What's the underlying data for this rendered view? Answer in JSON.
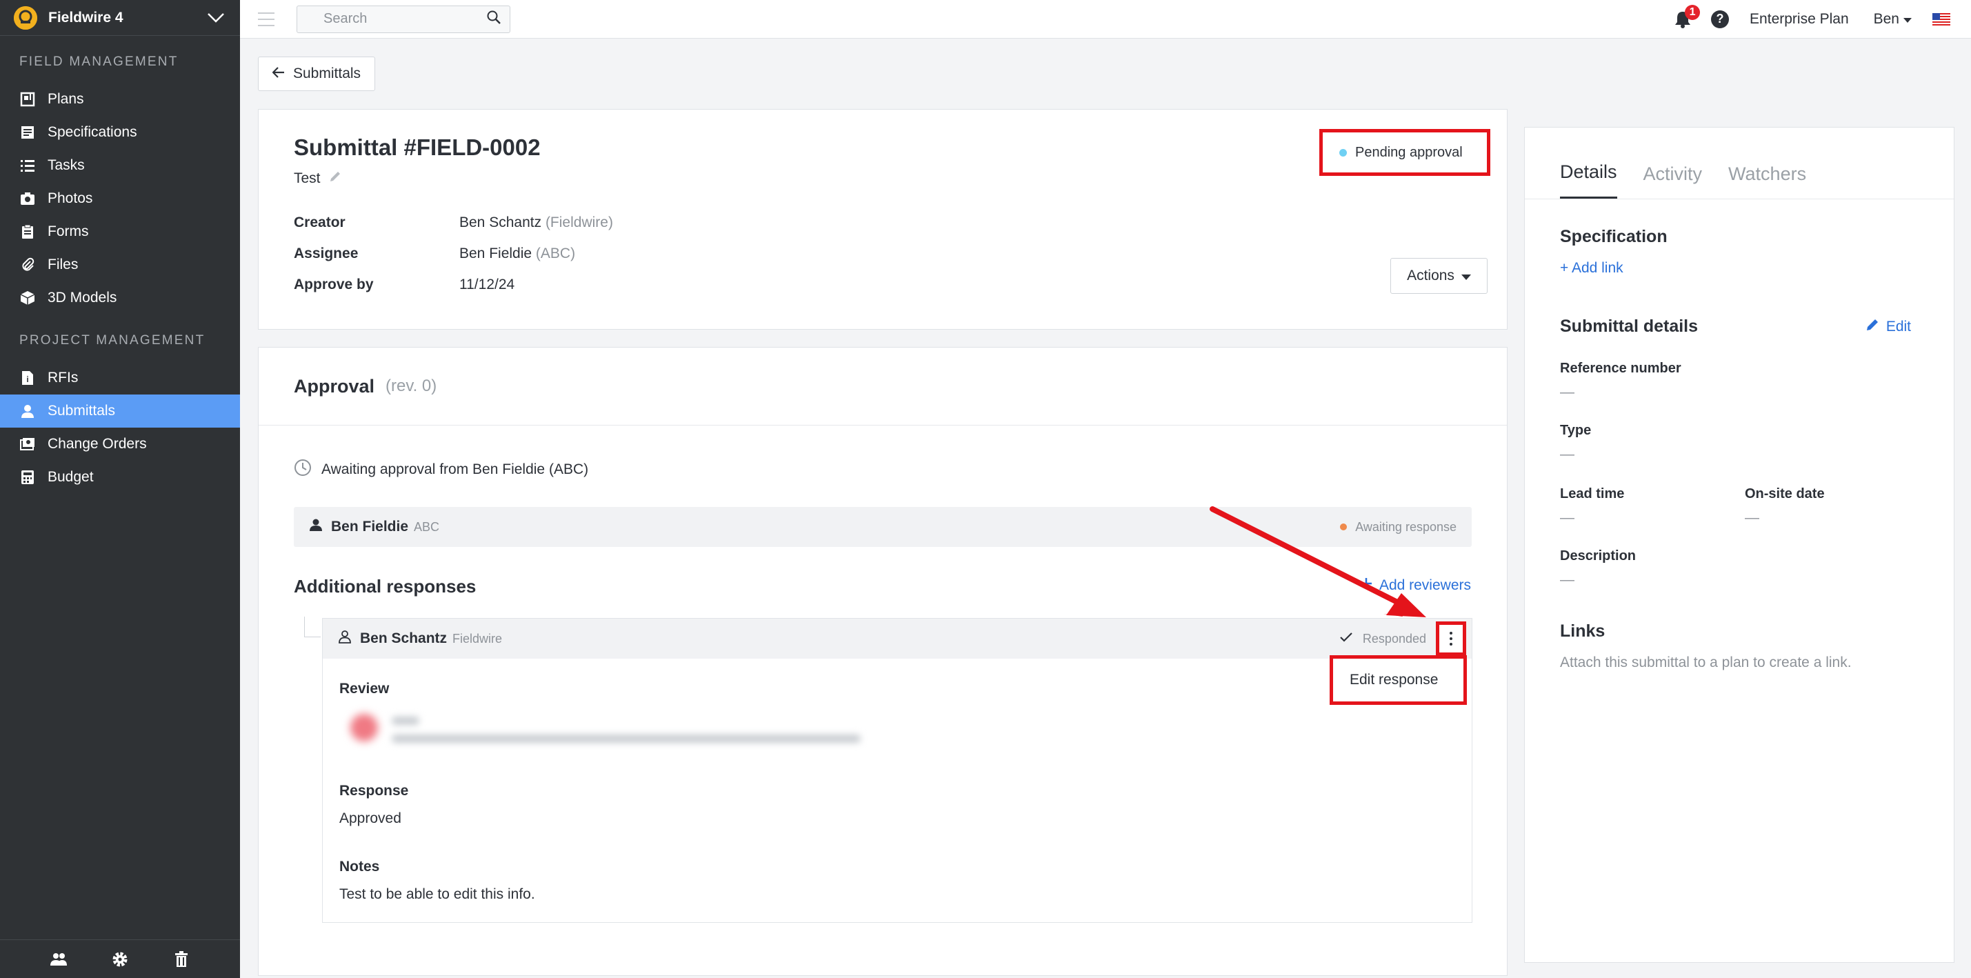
{
  "sidebar": {
    "project_name": "Fieldwire 4",
    "field_section_title": "FIELD MANAGEMENT",
    "field_items": [
      {
        "label": "Plans",
        "icon": "plans-icon"
      },
      {
        "label": "Specifications",
        "icon": "specifications-icon"
      },
      {
        "label": "Tasks",
        "icon": "tasks-icon"
      },
      {
        "label": "Photos",
        "icon": "camera-icon"
      },
      {
        "label": "Forms",
        "icon": "forms-icon"
      },
      {
        "label": "Files",
        "icon": "paperclip-icon"
      },
      {
        "label": "3D Models",
        "icon": "cube-icon"
      }
    ],
    "project_section_title": "PROJECT MANAGEMENT",
    "project_items": [
      {
        "label": "RFIs",
        "icon": "rfi-icon"
      },
      {
        "label": "Submittals",
        "icon": "submittals-icon",
        "active": true
      },
      {
        "label": "Change Orders",
        "icon": "change-orders-icon"
      },
      {
        "label": "Budget",
        "icon": "calculator-icon"
      }
    ]
  },
  "topbar": {
    "search_placeholder": "Search",
    "notification_count": "1",
    "help_label": "?",
    "plan_label": "Enterprise Plan",
    "user_label": "Ben"
  },
  "back_button": {
    "label": "Submittals"
  },
  "submittal": {
    "title": "Submittal #FIELD-0002",
    "name": "Test",
    "status": "Pending approval",
    "status_color": "#6fd0f3",
    "creator_label": "Creator",
    "creator_name": "Ben Schantz",
    "creator_org": "(Fieldwire)",
    "assignee_label": "Assignee",
    "assignee_name": "Ben Fieldie",
    "assignee_org": "(ABC)",
    "approve_by_label": "Approve by",
    "approve_by_value": "11/12/24",
    "actions_label": "Actions"
  },
  "approval": {
    "title": "Approval",
    "rev": "(rev. 0)",
    "awaiting_text": "Awaiting approval from Ben Fieldie (ABC)",
    "reviewer_name": "Ben Fieldie",
    "reviewer_org": "ABC",
    "reviewer_status": "Awaiting response",
    "additional_title": "Additional responses",
    "add_reviewers_label": "Add reviewers",
    "response": {
      "name": "Ben Schantz",
      "org": "Fieldwire",
      "status": "Responded",
      "review_label": "Review",
      "response_label": "Response",
      "response_value": "Approved",
      "notes_label": "Notes",
      "notes_value": "Test to be able to edit this info."
    },
    "menu": {
      "edit_response_label": "Edit response"
    }
  },
  "right_panel": {
    "tabs": [
      "Details",
      "Activity",
      "Watchers"
    ],
    "specification_title": "Specification",
    "add_link_label": "+ Add link",
    "submittal_details_title": "Submittal details",
    "edit_label": "Edit",
    "reference_number_label": "Reference number",
    "reference_number_value": "—",
    "type_label": "Type",
    "type_value": "—",
    "lead_time_label": "Lead time",
    "lead_time_value": "—",
    "onsite_date_label": "On-site date",
    "onsite_date_value": "—",
    "description_label": "Description",
    "description_value": "—",
    "links_title": "Links",
    "links_text": "Attach this submittal to a plan to create a link."
  },
  "colors": {
    "accent_blue": "#2a70d9",
    "sidebar_active": "#5b9cf5",
    "highlight_red": "#e4141b"
  }
}
